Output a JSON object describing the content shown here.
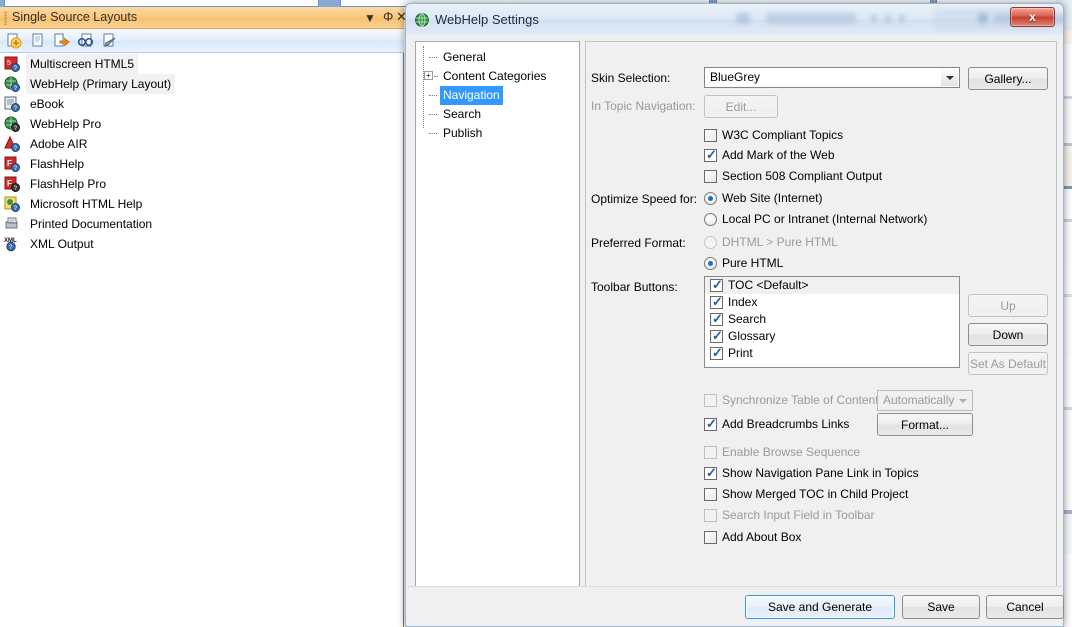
{
  "background": {
    "panel": {
      "title": "Single Source Layouts",
      "header_buttons": [
        {
          "name": "dropdown-caret",
          "glyph": "▼"
        },
        {
          "name": "pin",
          "glyph": "Φ"
        },
        {
          "name": "close",
          "glyph": "✕"
        }
      ],
      "toolbar_icons": [
        "new-layout-icon",
        "copy-layout-icon",
        "generate-icon",
        "view-output-icon",
        "properties-icon"
      ],
      "items": [
        {
          "label": "Multiscreen HTML5",
          "icon": "multiscreen-html5-icon",
          "selected": false
        },
        {
          "label": "WebHelp (Primary Layout)",
          "icon": "webhelp-icon",
          "selected": true
        },
        {
          "label": "eBook",
          "icon": "ebook-icon",
          "selected": false
        },
        {
          "label": "WebHelp Pro",
          "icon": "webhelp-pro-icon",
          "selected": false
        },
        {
          "label": "Adobe AIR",
          "icon": "adobe-air-icon",
          "selected": false
        },
        {
          "label": "FlashHelp",
          "icon": "flashhelp-icon",
          "selected": false
        },
        {
          "label": "FlashHelp Pro",
          "icon": "flashhelp-pro-icon",
          "selected": false
        },
        {
          "label": "Microsoft HTML Help",
          "icon": "ms-html-help-icon",
          "selected": false
        },
        {
          "label": "Printed Documentation",
          "icon": "printed-doc-icon",
          "selected": false
        },
        {
          "label": "XML Output",
          "icon": "xml-output-icon",
          "selected": false
        }
      ]
    }
  },
  "dialog": {
    "title": "WebHelp Settings",
    "icon": "globe-icon",
    "close_label": "x",
    "tree": {
      "nodes": [
        {
          "label": "General",
          "selected": false,
          "expandable": false
        },
        {
          "label": "Content Categories",
          "selected": false,
          "expandable": true,
          "expander": "+"
        },
        {
          "label": "Navigation",
          "selected": true,
          "expandable": false
        },
        {
          "label": "Search",
          "selected": false,
          "expandable": false
        },
        {
          "label": "Publish",
          "selected": false,
          "expandable": false
        }
      ]
    },
    "form": {
      "skin_selection_label": "Skin Selection:",
      "skin_selection_value": "BlueGrey",
      "gallery_button": "Gallery...",
      "in_topic_nav_label": "In Topic Navigation:",
      "edit_button": "Edit...",
      "checkboxes_top": [
        {
          "label": "W3C Compliant Topics",
          "checked": false,
          "enabled": true
        },
        {
          "label": "Add Mark of the Web",
          "checked": true,
          "enabled": true
        },
        {
          "label": "Section 508 Compliant Output",
          "checked": false,
          "enabled": true
        }
      ],
      "optimize_label": "Optimize Speed for:",
      "optimize_options": [
        {
          "label": "Web Site (Internet)",
          "selected": true,
          "enabled": true
        },
        {
          "label": "Local PC or Intranet (Internal Network)",
          "selected": false,
          "enabled": true
        }
      ],
      "preferred_format_label": "Preferred Format:",
      "preferred_format_options": [
        {
          "label": "DHTML > Pure HTML",
          "selected": false,
          "enabled": false
        },
        {
          "label": "Pure HTML",
          "selected": true,
          "enabled": true
        }
      ],
      "toolbar_buttons_label": "Toolbar Buttons:",
      "toolbar_buttons_list": [
        {
          "label": "TOC <Default>",
          "checked": true,
          "highlighted": true
        },
        {
          "label": "Index",
          "checked": true,
          "highlighted": false
        },
        {
          "label": "Search",
          "checked": true,
          "highlighted": false
        },
        {
          "label": "Glossary",
          "checked": true,
          "highlighted": false
        },
        {
          "label": "Print",
          "checked": true,
          "highlighted": false
        }
      ],
      "side_buttons": [
        {
          "label": "Up",
          "enabled": false
        },
        {
          "label": "Down",
          "enabled": true
        },
        {
          "label": "Set As Default",
          "enabled": false
        }
      ],
      "sync_toc_label": "Synchronize Table of Contents",
      "sync_toc_checked": false,
      "sync_toc_enabled": false,
      "sync_toc_mode": "Automatically",
      "breadcrumbs_label": "Add Breadcrumbs Links",
      "breadcrumbs_checked": true,
      "format_button": "Format...",
      "checkboxes_bottom": [
        {
          "label": "Enable Browse Sequence",
          "checked": false,
          "enabled": false
        },
        {
          "label": "Show Navigation Pane Link in Topics",
          "checked": true,
          "enabled": true
        },
        {
          "label": "Show Merged TOC in Child Project",
          "checked": false,
          "enabled": true
        },
        {
          "label": "Search Input Field in Toolbar",
          "checked": false,
          "enabled": false
        },
        {
          "label": "Add About Box",
          "checked": false,
          "enabled": true
        }
      ]
    },
    "footer_buttons": [
      {
        "label": "Save and Generate",
        "default": true
      },
      {
        "label": "Save",
        "default": false
      },
      {
        "label": "Cancel",
        "default": false
      }
    ]
  },
  "colors": {
    "panel_header_orange": "#fac87f",
    "selection_blue": "#3399ff",
    "default_button_border": "#3c97d0",
    "close_button_red": "#c44030",
    "checkbox_tick": "#1b5fa8"
  }
}
